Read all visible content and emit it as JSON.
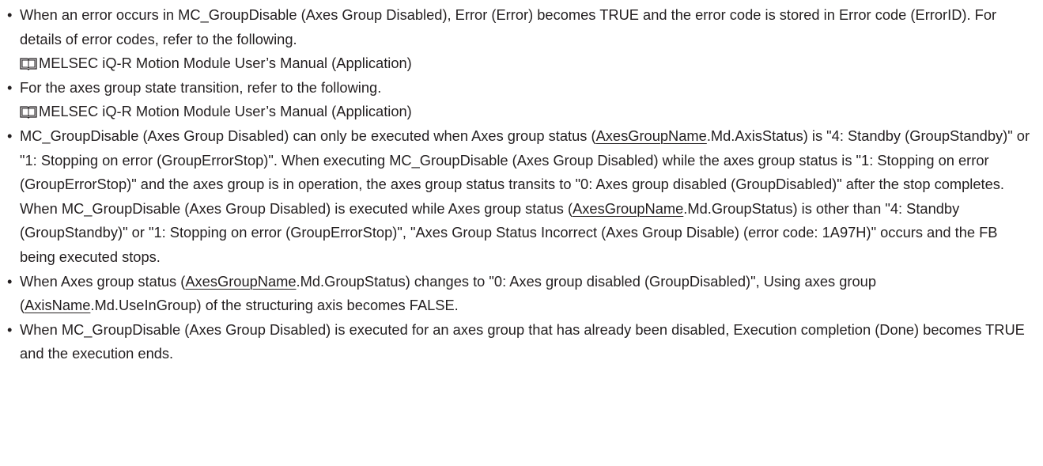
{
  "bullet_glyph": "•",
  "icons": {
    "reference": "book-icon"
  },
  "items": [
    {
      "p1": "When an error occurs in MC_GroupDisable (Axes Group Disabled), Error (Error) becomes TRUE and the error code is stored in Error code (ErrorID). For details of error codes, refer to the following.",
      "ref": "MELSEC iQ-R Motion Module User’s Manual (Application)"
    },
    {
      "p1": "For the axes group state transition, refer to the following.",
      "ref": "MELSEC iQ-R Motion Module User’s Manual (Application)"
    },
    {
      "p1": "MC_GroupDisable (Axes Group Disabled) can only be executed when Axes group status (",
      "u1": "AxesGroupName",
      "p2": ".Md.AxisStatus) is \"4: Standby (GroupStandby)\" or \"1: Stopping on error (GroupErrorStop)\". When executing MC_GroupDisable (Axes Group Disabled) while the axes group status is \"1: Stopping on error (GroupErrorStop)\" and the axes group is in operation, the axes group status transits to \"0: Axes group disabled (GroupDisabled)\" after the stop completes. When MC_GroupDisable (Axes Group Disabled) is executed while Axes group status (",
      "u2": "AxesGroupName",
      "p3": ".Md.GroupStatus) is other than \"4: Standby (GroupStandby)\" or \"1: Stopping on error (GroupErrorStop)\", \"Axes Group Status Incorrect (Axes Group Disable) (error code: 1A97H)\" occurs and the FB being executed stops."
    },
    {
      "p1": "When Axes group status (",
      "u1": "AxesGroupName",
      "p2": ".Md.GroupStatus) changes to \"0: Axes group disabled (GroupDisabled)\", Using axes group (",
      "u2": "AxisName",
      "p3": ".Md.UseInGroup) of the structuring axis becomes FALSE."
    },
    {
      "p1": "When MC_GroupDisable (Axes Group Disabled) is executed for an axes group that has already been disabled, Execution completion (Done) becomes TRUE and the execution ends."
    }
  ]
}
